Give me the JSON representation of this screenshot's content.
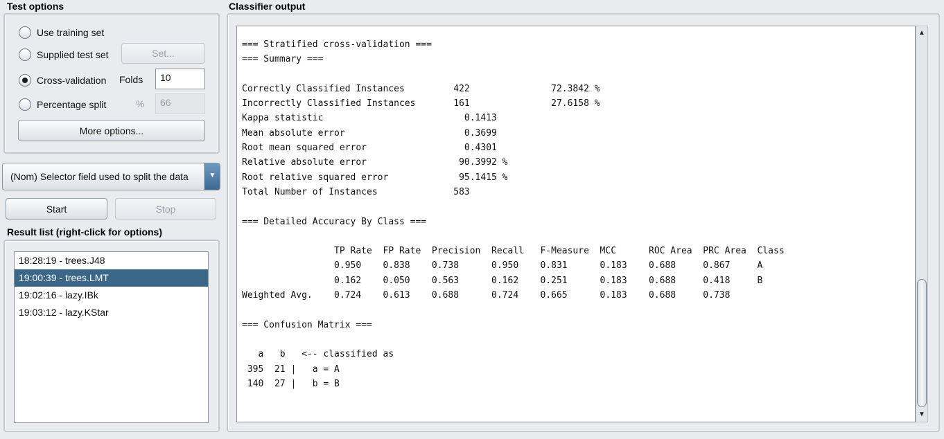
{
  "test_options": {
    "title": "Test options",
    "use_training_set": "Use training set",
    "supplied_test_set": "Supplied test set",
    "set_button": "Set...",
    "cross_validation": "Cross-validation",
    "folds_label": "Folds",
    "folds_value": "10",
    "percentage_split": "Percentage split",
    "percent_symbol": "%",
    "percentage_value": "66",
    "more_options": "More options...",
    "selected": "cross_validation"
  },
  "selector": {
    "value": "(Nom) Selector field used to split the data",
    "arrow_icon": "triangle-down"
  },
  "controls": {
    "start": "Start",
    "stop": "Stop"
  },
  "result_list": {
    "title": "Result list (right-click for options)",
    "items": [
      "18:28:19 - trees.J48",
      "19:00:39 - trees.LMT",
      "19:02:16 - lazy.IBk",
      "19:03:12 - lazy.KStar"
    ],
    "selected_index": 1
  },
  "classifier_output": {
    "title": "Classifier output",
    "lines": [
      "=== Stratified cross-validation ===",
      "=== Summary ===",
      "",
      "Correctly Classified Instances         422               72.3842 %",
      "Incorrectly Classified Instances       161               27.6158 %",
      "Kappa statistic                          0.1413",
      "Mean absolute error                      0.3699",
      "Root mean squared error                  0.4301",
      "Relative absolute error                 90.3992 %",
      "Root relative squared error             95.1415 %",
      "Total Number of Instances              583",
      "",
      "=== Detailed Accuracy By Class ===",
      "",
      "                 TP Rate  FP Rate  Precision  Recall   F-Measure  MCC      ROC Area  PRC Area  Class",
      "                 0.950    0.838    0.738      0.950    0.831      0.183    0.688     0.867     A",
      "                 0.162    0.050    0.563      0.162    0.251      0.183    0.688     0.418     B",
      "Weighted Avg.    0.724    0.613    0.688      0.724    0.665      0.183    0.688     0.738",
      "",
      "=== Confusion Matrix ===",
      "",
      "   a   b   <-- classified as",
      " 395  21 |   a = A",
      " 140  27 |   b = B"
    ]
  },
  "colors": {
    "background": "#e9ebee",
    "selection": "#3a6688",
    "combo_arrow": "#3d6a93"
  }
}
